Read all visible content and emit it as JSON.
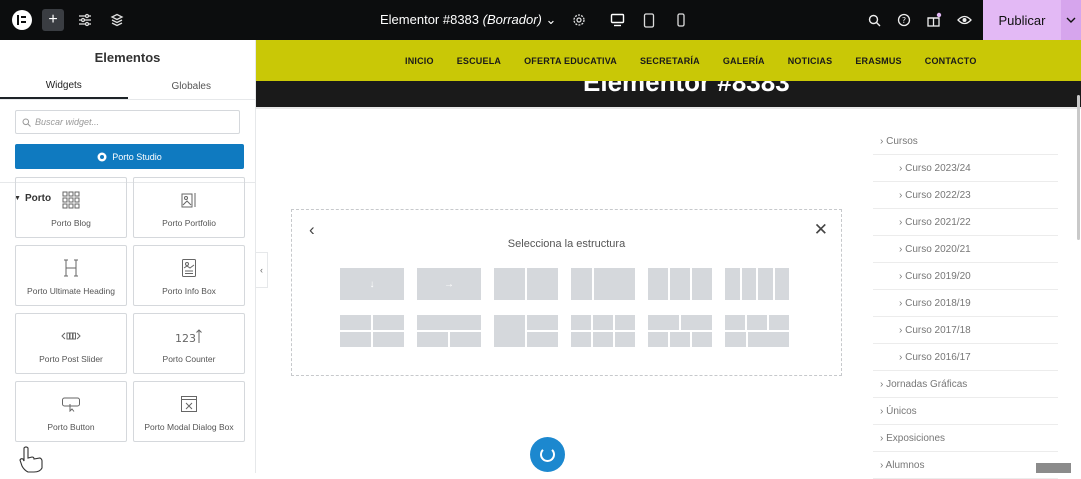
{
  "topbar": {
    "document_title": "Elementor #8383",
    "document_status": "(Borrador)",
    "publish_label": "Publicar",
    "icons": [
      "elementor-logo-icon",
      "add-element-icon",
      "site-settings-icon",
      "structure-icon",
      "page-settings-icon",
      "desktop-icon",
      "tablet-icon",
      "mobile-icon",
      "search-icon",
      "help-icon",
      "whats-new-icon",
      "preview-icon",
      "chevron-down-icon"
    ]
  },
  "panel": {
    "title": "Elementos",
    "tabs": [
      "Widgets",
      "Globales"
    ],
    "search_placeholder": "Buscar widget...",
    "studio_button": "Porto Studio",
    "category": "Porto",
    "widgets": [
      {
        "label": "Porto Blog",
        "icon": "blog-grid-icon"
      },
      {
        "label": "Porto Portfolio",
        "icon": "portfolio-icon"
      },
      {
        "label": "Porto Ultimate Heading",
        "icon": "heading-icon"
      },
      {
        "label": "Porto Info Box",
        "icon": "info-box-icon"
      },
      {
        "label": "Porto Post Slider",
        "icon": "post-slider-icon"
      },
      {
        "label": "Porto Counter",
        "icon": "counter-icon"
      },
      {
        "label": "Porto Button",
        "icon": "button-icon"
      },
      {
        "label": "Porto Modal Dialog Box",
        "icon": "modal-dialog-icon"
      }
    ]
  },
  "site": {
    "nav": [
      "INICIO",
      "ESCUELA",
      "OFERTA EDUCATIVA",
      "SECRETARÍA",
      "GALERÍA",
      "NOTICIAS",
      "ERASMUS",
      "CONTACTO"
    ],
    "hero_title": "Elementor #8383",
    "structure": {
      "title": "Selecciona la estructura",
      "back_label": "‹",
      "close_label": "✕",
      "arrow_down": "↓",
      "arrow_right": "→"
    },
    "sidebar": [
      {
        "label": "› Cursos",
        "level": 0
      },
      {
        "label": "› Curso 2023/24",
        "level": 1
      },
      {
        "label": "› Curso 2022/23",
        "level": 1
      },
      {
        "label": "› Curso 2021/22",
        "level": 1
      },
      {
        "label": "› Curso 2020/21",
        "level": 1
      },
      {
        "label": "› Curso 2019/20",
        "level": 1
      },
      {
        "label": "› Curso 2018/19",
        "level": 1
      },
      {
        "label": "› Curso 2017/18",
        "level": 1
      },
      {
        "label": "› Curso 2016/17",
        "level": 1
      },
      {
        "label": "› Jornadas Gráficas",
        "level": 0
      },
      {
        "label": "› Únicos",
        "level": 0
      },
      {
        "label": "› Exposiciones",
        "level": 0
      },
      {
        "label": "› Alumnos",
        "level": 0
      }
    ]
  },
  "colors": {
    "topbar": "#0c0d0e",
    "publish": "#e3b9f5",
    "nav": "#c9c806",
    "studio": "#0f7ac0",
    "spinner": "#1c88cf"
  }
}
